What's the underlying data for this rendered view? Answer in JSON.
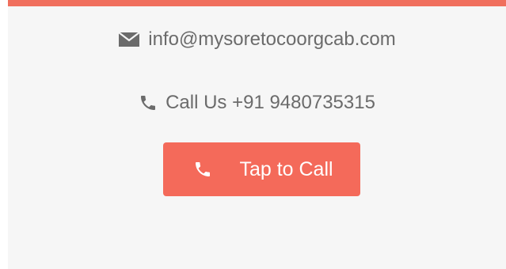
{
  "contact": {
    "email_icon": "envelope-icon",
    "email": "info@mysoretocoorgcab.com",
    "phone_icon": "phone-icon",
    "phone_text": "Call Us +91 9480735315"
  },
  "call_button": {
    "icon": "phone-icon",
    "label": "Tap to Call",
    "background": "#f46a5a",
    "text_color": "#ffffff"
  },
  "colors": {
    "accent": "#f06f5d",
    "panel_background": "#f6f6f6",
    "text": "#6b6b6b"
  }
}
